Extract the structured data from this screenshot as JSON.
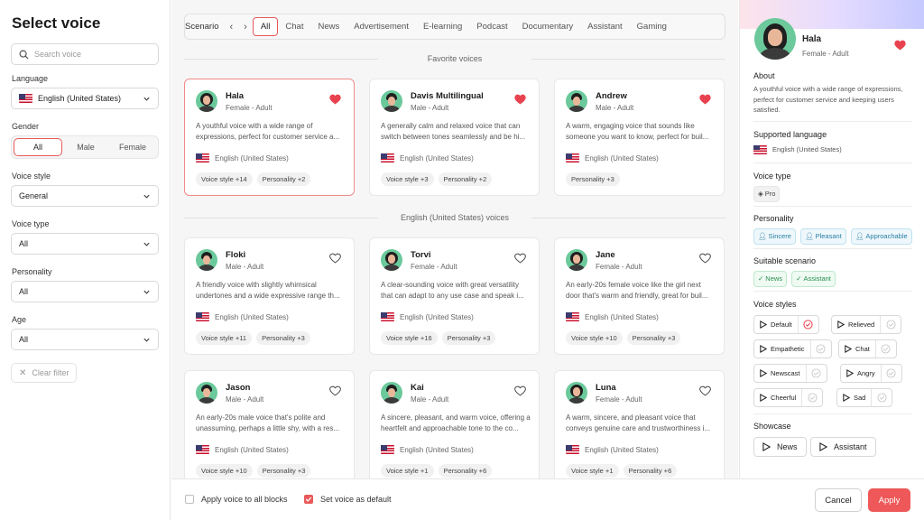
{
  "filters": {
    "title": "Select voice",
    "search_placeholder": "Search voice",
    "language_label": "Language",
    "language_value": "English (United States)",
    "gender_label": "Gender",
    "gender_options": [
      "All",
      "Male",
      "Female"
    ],
    "gender_selected": "All",
    "voice_style_label": "Voice style",
    "voice_style_value": "General",
    "voice_type_label": "Voice type",
    "voice_type_value": "All",
    "personality_label": "Personality",
    "personality_value": "All",
    "age_label": "Age",
    "age_value": "All",
    "clear_label": "Clear filter"
  },
  "scenario": {
    "label": "Scenario",
    "tabs": [
      "All",
      "Chat",
      "News",
      "Advertisement",
      "E-learning",
      "Podcast",
      "Documentary",
      "Assistant",
      "Gaming"
    ],
    "selected": "All"
  },
  "sections": {
    "favorites": "Favorite voices",
    "english": "English (United States) voices"
  },
  "favorites": [
    {
      "name": "Hala",
      "meta": "Female - Adult",
      "desc": "A youthful voice with a wide range of expressions, perfect for customer service a...",
      "lang": "English (United States)",
      "chips": [
        "Voice style +14",
        "Personality +2"
      ],
      "fav": true,
      "selected": true,
      "avatar": "female"
    },
    {
      "name": "Davis Multilingual",
      "meta": "Male - Adult",
      "desc": "A generally calm and relaxed voice that can switch between tones seamlessly and be hi...",
      "lang": "English (United States)",
      "chips": [
        "Voice style +3",
        "Personality +2"
      ],
      "fav": true,
      "selected": false,
      "avatar": "male"
    },
    {
      "name": "Andrew",
      "meta": "Male - Adult",
      "desc": "A warm, engaging voice that sounds like someone you want to know, perfect for buil...",
      "lang": "English (United States)",
      "chips": [
        "Personality +3"
      ],
      "fav": true,
      "selected": false,
      "avatar": "male"
    }
  ],
  "voices": [
    {
      "name": "Floki",
      "meta": "Male - Adult",
      "desc": "A friendly voice with slightly whimsical undertones and a wide expressive range th...",
      "lang": "English (United States)",
      "chips": [
        "Voice style +11",
        "Personality +3"
      ],
      "fav": false,
      "avatar": "male"
    },
    {
      "name": "Torvi",
      "meta": "Female - Adult",
      "desc": "A clear-sounding voice with great versatility that can adapt to any use case and speak i...",
      "lang": "English (United States)",
      "chips": [
        "Voice style +16",
        "Personality +3"
      ],
      "fav": false,
      "avatar": "female"
    },
    {
      "name": "Jane",
      "meta": "Female - Adult",
      "desc": "An early-20s female voice like the girl next door that's warm and friendly, great for buil...",
      "lang": "English (United States)",
      "chips": [
        "Voice style +10",
        "Personality +3"
      ],
      "fav": false,
      "avatar": "female"
    },
    {
      "name": "Jason",
      "meta": "Male - Adult",
      "desc": "An early-20s male voice that's polite and unassuming, perhaps a little shy, with a res...",
      "lang": "English (United States)",
      "chips": [
        "Voice style +10",
        "Personality +3"
      ],
      "fav": false,
      "avatar": "male"
    },
    {
      "name": "Kai",
      "meta": "Male - Adult",
      "desc": "A sincere, pleasant, and warm voice, offering a heartfelt and approachable tone to the co...",
      "lang": "English (United States)",
      "chips": [
        "Voice style +1",
        "Personality +6"
      ],
      "fav": false,
      "avatar": "male"
    },
    {
      "name": "Luna",
      "meta": "Female - Adult",
      "desc": "A warm, sincere, and pleasant voice that conveys genuine care and trustworthiness i...",
      "lang": "English (United States)",
      "chips": [
        "Voice style +1",
        "Personality +6"
      ],
      "fav": false,
      "avatar": "female"
    }
  ],
  "detail": {
    "name": "Hala",
    "meta": "Female - Adult",
    "about_label": "About",
    "about": "A youthful voice with a wide range of expressions, perfect for customer service and keeping users satisfied.",
    "lang_label": "Supported language",
    "lang": "English (United States)",
    "type_label": "Voice type",
    "type": "Pro",
    "personality_label": "Personality",
    "personality": [
      "Sincere",
      "Pleasant",
      "Approachable"
    ],
    "scenario_label": "Suitable scenario",
    "scenario": [
      "News",
      "Assistant"
    ],
    "styles_label": "Voice styles",
    "styles": [
      "Default",
      "Relieved",
      "Empathetic",
      "Chat",
      "Newscast",
      "Angry",
      "Cheerful",
      "Sad"
    ],
    "style_selected": "Default",
    "showcase_label": "Showcase",
    "showcase": [
      "News",
      "Assistant"
    ]
  },
  "footer": {
    "apply_all": "Apply voice to all blocks",
    "apply_all_checked": false,
    "set_default": "Set voice as default",
    "set_default_checked": true,
    "cancel": "Cancel",
    "apply": "Apply"
  },
  "colors": {
    "accent": "#ee5858",
    "avatar_bg": "#6bc99b"
  }
}
